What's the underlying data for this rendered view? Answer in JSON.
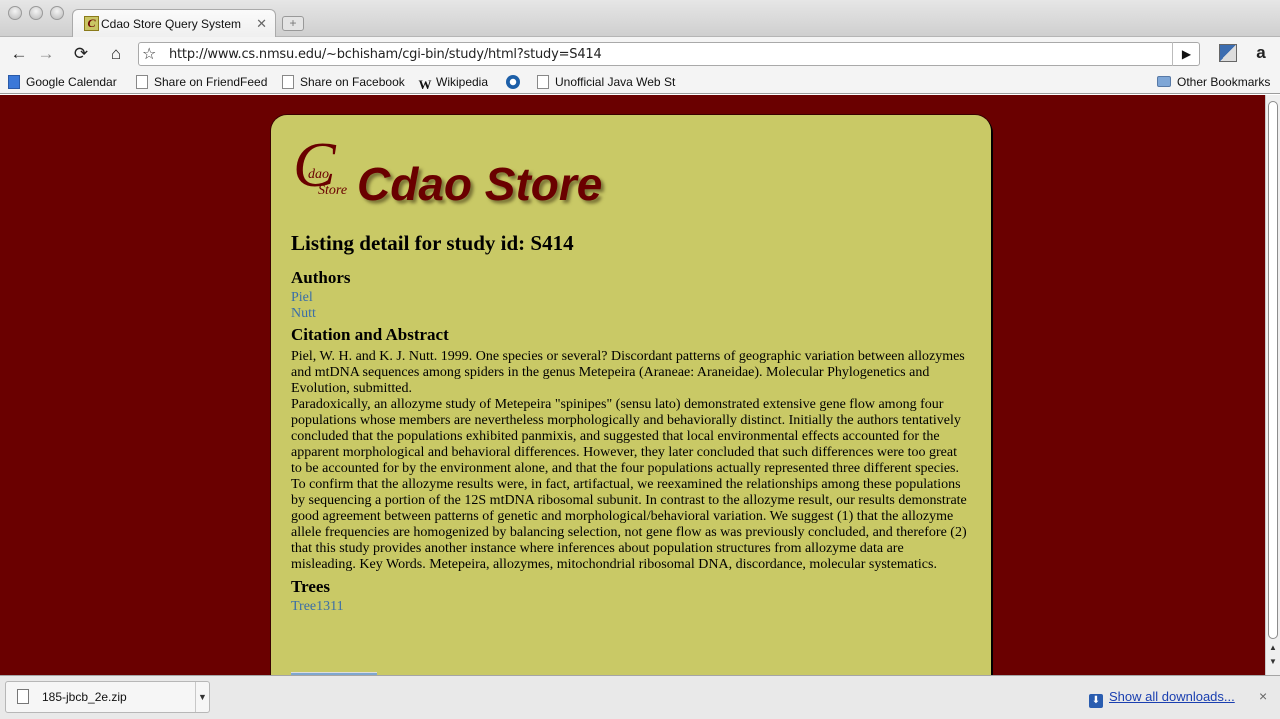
{
  "tab": {
    "title": "Cdao Store Query System",
    "favicon_letter": "C"
  },
  "toolbar": {
    "back_icon": "←",
    "forward_icon": "→",
    "reload_icon": "⟳",
    "home_icon": "⌂",
    "star_icon": "☆",
    "go_icon": "▶",
    "url": "http://www.cs.nmsu.edu/~bchisham/cgi-bin/study/html?study=S414",
    "amazon_letter": "a"
  },
  "bookmarks": {
    "items": [
      {
        "label": "Google Calendar"
      },
      {
        "label": "Share on FriendFeed"
      },
      {
        "label": "Share on Facebook"
      },
      {
        "label": "Wikipedia"
      },
      {
        "label": ""
      },
      {
        "label": "Unofficial Java Web St"
      }
    ],
    "wikipedia_letter": "W",
    "other": "Other Bookmarks"
  },
  "logo": {
    "big_c": "C",
    "dao": "dao",
    "store": "Store",
    "title": "Cdao Store"
  },
  "page": {
    "title": "Listing detail for study id: S414",
    "authors_heading": "Authors",
    "authors": [
      "Piel",
      "Nutt"
    ],
    "citation_heading": "Citation and Abstract",
    "citation": "Piel, W. H. and K. J. Nutt. 1999. One species or several? Discordant patterns of geographic variation between allozymes and mtDNA sequences among spiders in the genus Metepeira (Araneae: Araneidae). Molecular Phylogenetics and Evolution, submitted.",
    "abstract": "Paradoxically, an allozyme study of Metepeira \"spinipes\" (sensu lato) demonstrated extensive gene flow among four populations whose members are nevertheless morphologically and behaviorally distinct. Initially the authors tentatively concluded that the populations exhibited panmixis, and suggested that local environmental effects accounted for the apparent morphological and behavioral differences. However, they later concluded that such differences were too great to be accounted for by the environment alone, and that the four populations actually represented three different species. To confirm that the allozyme results were, in fact, artifactual, we reexamined the relationships among these populations by sequencing a portion of the 12S mtDNA ribosomal subunit. In contrast to the allozyme result, our results demonstrate good agreement between patterns of genetic and morphological/behavioral variation. We suggest (1) that the allozyme allele frequencies are homogenized by balancing selection, not gene flow as was previously concluded, and therefore (2) that this study provides another instance where inferences about population structures from allozyme data are misleading. Key Words. Metepeira, allozymes, mitochondrial ribosomal DNA, discordance, molecular systematics.",
    "trees_heading": "Trees",
    "trees": [
      "Tree1311"
    ]
  },
  "downloads": {
    "file": "185-jbcb_2e.zip",
    "show_all": "Show all downloads...",
    "close": "×"
  },
  "colors": {
    "page_bg": "#6a0000",
    "panel_bg": "#c9c966",
    "link": "#3a6ea8",
    "brand": "#6a0000"
  }
}
